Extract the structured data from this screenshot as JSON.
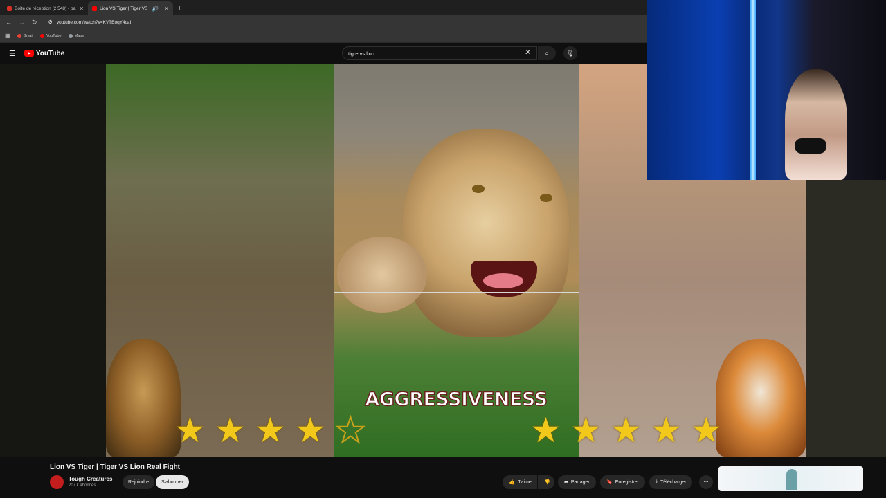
{
  "browser": {
    "tabs": [
      {
        "title": "Boîte de réception (2 548) - pa...",
        "active": false,
        "favicon_color": "#d93025"
      },
      {
        "title": "Lion VS Tiger | Tiger VS Lio...",
        "active": true,
        "favicon_color": "#ff0000"
      }
    ],
    "url": "youtube.com/watch?v=KVTEoqY4caI",
    "bookmarks": [
      {
        "label": "Gmail",
        "color": "#ea4335"
      },
      {
        "label": "YouTube",
        "color": "#ff0000"
      },
      {
        "label": "Maps",
        "color": "#9aa0a6"
      }
    ]
  },
  "youtube": {
    "logo": "YouTube",
    "search_value": "tigre vs lion"
  },
  "video": {
    "caption": "AGGRESSIVENESS",
    "lion_rating": 4,
    "lion_rating_max": 5,
    "tiger_rating": 5,
    "tiger_rating_max": 5,
    "title": "Lion VS Tiger | Tiger VS Lion Real Fight",
    "channel": "Tough Creatures",
    "subscribers": "207 k abonnés",
    "join_label": "Rejoindre",
    "subscribe_label": "S'abonner",
    "like_label": "J'aime",
    "share_label": "Partager",
    "save_label": "Enregistrer",
    "download_label": "Télécharger"
  },
  "icons": {
    "back": "back-arrow-icon",
    "forward": "forward-arrow-icon",
    "reload": "reload-icon",
    "menu": "hamburger-menu-icon",
    "search": "search-icon",
    "mic": "microphone-icon",
    "clear": "close-icon",
    "more": "more-horizontal-icon"
  },
  "colors": {
    "youtube_red": "#ff0000",
    "star": "#f2c91a",
    "bg": "#0f0f0f"
  }
}
